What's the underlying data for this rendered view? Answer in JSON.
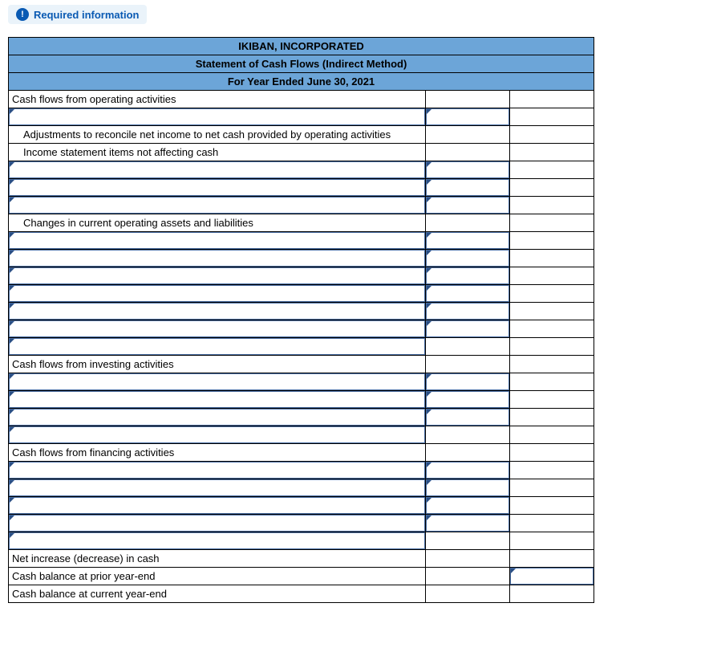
{
  "header": {
    "required_label": "Required information",
    "info_symbol": "!"
  },
  "title_rows": {
    "r1": "IKIBAN, INCORPORATED",
    "r2": "Statement of Cash Flows (Indirect Method)",
    "r3": "For Year Ended June 30, 2021"
  },
  "rows": {
    "op_header": "Cash flows from operating activities",
    "adj_line": "Adjustments to reconcile net income to net cash provided by operating activities",
    "income_stmt": "Income statement items not affecting cash",
    "changes_line": "Changes in current operating assets and liabilities",
    "inv_header": "Cash flows from investing activities",
    "fin_header": "Cash flows from financing activities",
    "net_inc": "Net increase (decrease) in cash",
    "prior": "Cash balance at prior year-end",
    "current": "Cash balance at current year-end"
  }
}
